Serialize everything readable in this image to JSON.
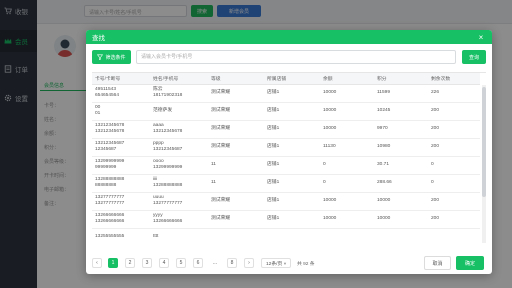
{
  "sidebar": {
    "items": [
      {
        "label": "收银",
        "icon": "cart-icon"
      },
      {
        "label": "会员",
        "icon": "crown-icon",
        "active": true
      },
      {
        "label": "订单",
        "icon": "order-icon"
      },
      {
        "label": "设置",
        "icon": "gear-icon"
      }
    ]
  },
  "topbar": {
    "search_placeholder": "请输入卡号/姓名/手机号",
    "search_label": "搜索",
    "add_label": "新增会员"
  },
  "background": {
    "tab_label": "会员信息",
    "rows": [
      "卡号：",
      "姓名：",
      "余额：",
      "积分：",
      "会员等级：",
      "开卡时间：",
      "电子邮箱：",
      "备注："
    ]
  },
  "modal": {
    "title": "查找",
    "close_icon": "×",
    "filter_label": "筛选条件",
    "search_placeholder": "请输入会员卡号/手机号",
    "query_label": "查询",
    "columns": [
      "卡号/卡断号",
      "姓名/手机号",
      "等级",
      "所属店铺",
      "余额",
      "积分",
      "剩余次数"
    ],
    "rows": [
      {
        "card": [
          "49511543",
          "654654564"
        ],
        "name": [
          "陈云",
          "18171902318"
        ],
        "level": "测试荣耀",
        "store": "店铺1",
        "balance": "10000",
        "points": "11599",
        "count": "226"
      },
      {
        "card": [
          "00",
          "01"
        ],
        "name": [
          "范德萨发",
          ""
        ],
        "level": "测试荣耀",
        "store": "店铺1",
        "balance": "10000",
        "points": "10245",
        "count": "200"
      },
      {
        "card": [
          "13212345678",
          "13212345678"
        ],
        "name": [
          "aaaa",
          "13212345678"
        ],
        "level": "测试荣耀",
        "store": "店铺1",
        "balance": "10000",
        "points": "9970",
        "count": "200"
      },
      {
        "card": [
          "13212345687",
          "12345687"
        ],
        "name": [
          "pppp",
          "13212345687"
        ],
        "level": "测试荣耀",
        "store": "店铺1",
        "balance": "11130",
        "points": "10980",
        "count": "200"
      },
      {
        "card": [
          "13299999999",
          "99999999"
        ],
        "name": [
          "oooo",
          "13299999999"
        ],
        "level": "11",
        "store": "店铺1",
        "balance": "0",
        "points": "30.71",
        "count": "0"
      },
      {
        "card": [
          "13288888888",
          "88888888"
        ],
        "name": [
          "iiii",
          "13288888888"
        ],
        "level": "11",
        "store": "店铺1",
        "balance": "0",
        "points": "288.66",
        "count": "0"
      },
      {
        "card": [
          "13277777777",
          "13277777777"
        ],
        "name": [
          "uuuu",
          "13277777777"
        ],
        "level": "测试荣耀",
        "store": "店铺1",
        "balance": "10000",
        "points": "10000",
        "count": "200"
      },
      {
        "card": [
          "13266666666",
          "13266666666"
        ],
        "name": [
          "yyyy",
          "13266666666"
        ],
        "level": "测试荣耀",
        "store": "店铺1",
        "balance": "10000",
        "points": "10000",
        "count": "200"
      },
      {
        "card": [
          "13255555555",
          ""
        ],
        "name": [
          "tttt",
          ""
        ],
        "level": "",
        "store": "",
        "balance": "",
        "points": "",
        "count": ""
      }
    ],
    "pagination": {
      "pages": [
        "1",
        "2",
        "3",
        "4",
        "5",
        "6",
        "...",
        "8"
      ],
      "current": "1",
      "prev": "‹",
      "next": "›",
      "page_size": "12条/页",
      "total": "共 92 条"
    },
    "cancel_label": "取消",
    "ok_label": "确定"
  },
  "colors": {
    "accent": "#17c065",
    "sidebar_bg": "#2f3640"
  }
}
